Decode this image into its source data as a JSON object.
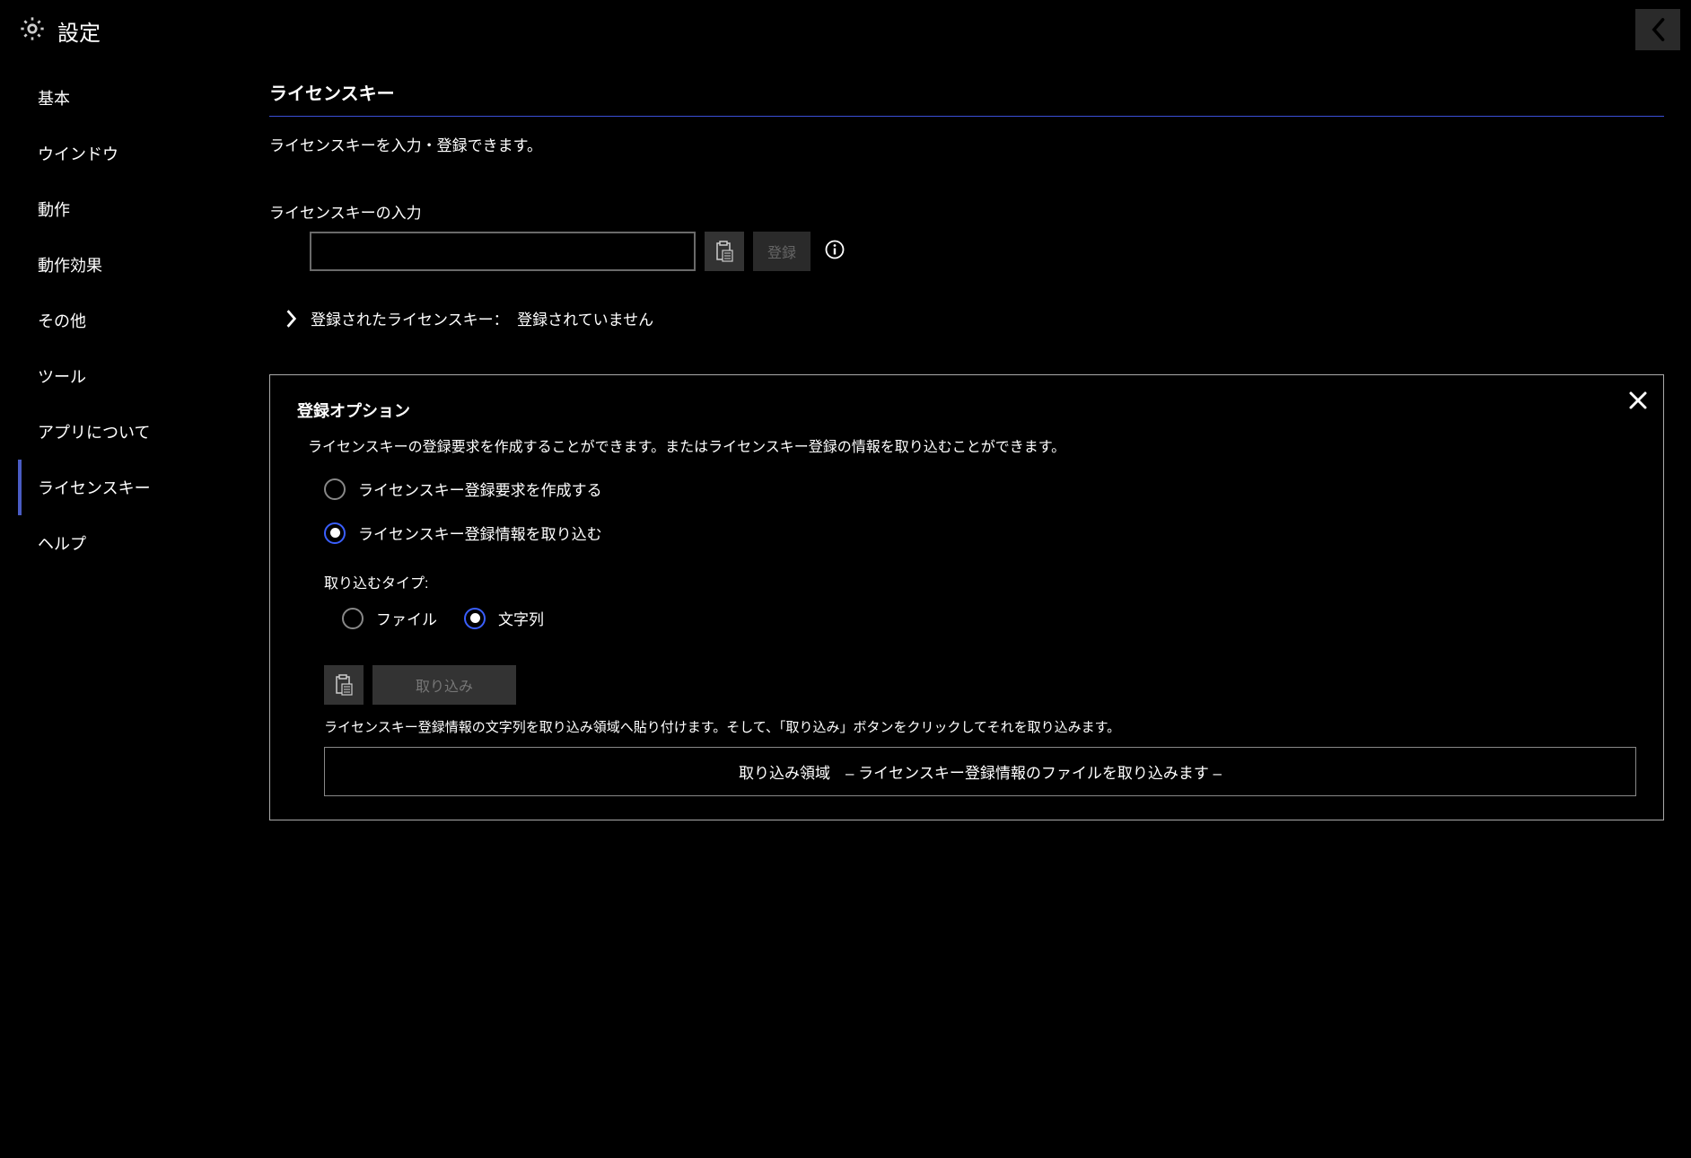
{
  "header": {
    "title": "設定"
  },
  "sidebar": {
    "items": [
      {
        "label": "基本"
      },
      {
        "label": "ウインドウ"
      },
      {
        "label": "動作"
      },
      {
        "label": "動作効果"
      },
      {
        "label": "その他"
      },
      {
        "label": "ツール"
      },
      {
        "label": "アプリについて"
      },
      {
        "label": "ライセンスキー"
      },
      {
        "label": "ヘルプ"
      }
    ]
  },
  "main": {
    "section_title": "ライセンスキー",
    "section_desc": "ライセンスキーを入力・登録できます。",
    "input_label": "ライセンスキーの入力",
    "register_button": "登録",
    "registered_label": "登録されたライセンスキー：",
    "registered_value": "登録されていません"
  },
  "panel": {
    "title": "登録オプション",
    "desc": "ライセンスキーの登録要求を作成することができます。またはライセンスキー登録の情報を取り込むことができます。",
    "radio_create": "ライセンスキー登録要求を作成する",
    "radio_import": "ライセンスキー登録情報を取り込む",
    "import_type_label": "取り込むタイプ:",
    "import_type_file": "ファイル",
    "import_type_string": "文字列",
    "import_button": "取り込み",
    "import_hint": "ライセンスキー登録情報の文字列を取り込み領域へ貼り付けます。そして、「取り込み」ボタンをクリックしてそれを取り込みます。",
    "import_area": "取り込み領域　– ライセンスキー登録情報のファイルを取り込みます –"
  }
}
